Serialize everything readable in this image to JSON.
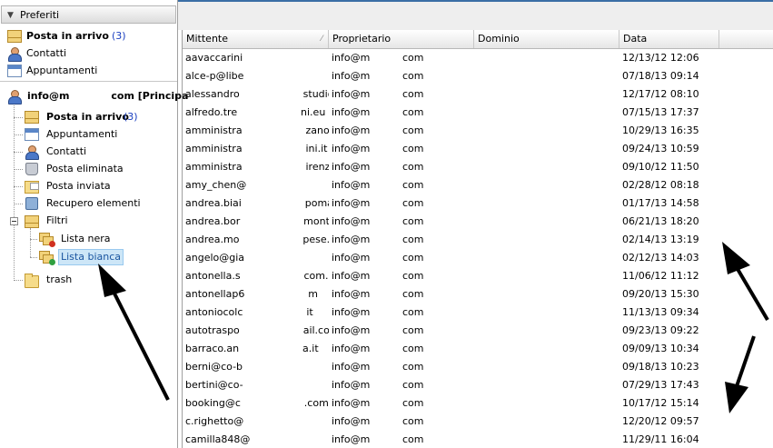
{
  "favorites": {
    "header": "Preferiti",
    "items": [
      {
        "label": "Posta in arrivo",
        "count": "(3)",
        "icon": "inbox-icon",
        "bold": true
      },
      {
        "label": "Contatti",
        "icon": "contacts-icon",
        "bold": false
      },
      {
        "label": "Appuntamenti",
        "icon": "calendar-icon",
        "bold": false
      }
    ]
  },
  "account": {
    "label": "info@m            com [Principa",
    "folders": [
      {
        "label": "Posta in arrivo",
        "count": "(3)",
        "icon": "inbox-icon",
        "bold": true
      },
      {
        "label": "Appuntamenti",
        "icon": "calendar-icon"
      },
      {
        "label": "Contatti",
        "icon": "contacts-icon"
      },
      {
        "label": "Posta eliminata",
        "icon": "trash-can-icon"
      },
      {
        "label": "Posta inviata",
        "icon": "sent-mail-icon"
      },
      {
        "label": "Recupero elementi",
        "icon": "recover-items-icon"
      },
      {
        "label": "Filtri",
        "icon": "filters-icon"
      },
      {
        "label": "Lista nera",
        "icon": "blacklist-icon"
      },
      {
        "label": "Lista bianca",
        "icon": "whitelist-icon"
      },
      {
        "label": "trash",
        "icon": "folder-icon"
      }
    ]
  },
  "grid": {
    "columns": [
      "Mittente",
      "Proprietario",
      "Dominio",
      "Data"
    ],
    "rows": [
      {
        "sender": "aavaccarini",
        "owner": "info@m",
        "domain": "com",
        "date": "12/13/12 12:06"
      },
      {
        "sender": "alce-p@libe",
        "owner": "info@m",
        "domain": "com",
        "date": "07/18/13 09:14"
      },
      {
        "sender": "alessandro                    studio.it",
        "owner": "info@m",
        "domain": "com",
        "date": "12/17/12 08:10"
      },
      {
        "sender": "alfredo.tre                    ni.eu",
        "owner": "info@m",
        "domain": "com",
        "date": "07/15/13 17:37"
      },
      {
        "sender": "amministra                    zanoasf",
        "owner": "info@m",
        "domain": "com",
        "date": "10/29/13 16:35"
      },
      {
        "sender": "amministra                    ini.it",
        "owner": "info@m",
        "domain": "com",
        "date": "09/24/13 10:59"
      },
      {
        "sender": "amministra                    irenzosp",
        "owner": "info@m",
        "domain": "com",
        "date": "09/10/12 11:50"
      },
      {
        "sender": "amy_chen@",
        "owner": "info@m",
        "domain": "com",
        "date": "02/28/12 08:18"
      },
      {
        "sender": "andrea.biai                    pomann",
        "owner": "info@m",
        "domain": "com",
        "date": "01/17/13 14:58"
      },
      {
        "sender": "andrea.bor                    montana",
        "owner": "info@m",
        "domain": "com",
        "date": "06/21/13 18:20"
      },
      {
        "sender": "andrea.mo                    pese.co",
        "owner": "info@m",
        "domain": "com",
        "date": "02/14/13 13:19"
      },
      {
        "sender": "angelo@gia",
        "owner": "info@m",
        "domain": "com",
        "date": "02/12/13 14:03"
      },
      {
        "sender": "antonella.s                    com.it",
        "owner": "info@m",
        "domain": "com",
        "date": "11/06/12 11:12"
      },
      {
        "sender": "antonellap6                    m",
        "owner": "info@m",
        "domain": "com",
        "date": "09/20/13 15:30"
      },
      {
        "sender": "antoniocolc                    it",
        "owner": "info@m",
        "domain": "com",
        "date": "11/13/13 09:34"
      },
      {
        "sender": "autotraspo                    ail.com",
        "owner": "info@m",
        "domain": "com",
        "date": "09/23/13 09:22"
      },
      {
        "sender": "barraco.an                    a.it",
        "owner": "info@m",
        "domain": "com",
        "date": "09/09/13 10:34"
      },
      {
        "sender": "berni@co-b",
        "owner": "info@m",
        "domain": "com",
        "date": "09/18/13 10:23"
      },
      {
        "sender": "bertini@co-",
        "owner": "info@m",
        "domain": "com",
        "date": "07/29/13 17:43"
      },
      {
        "sender": "booking@c                    .com",
        "owner": "info@m",
        "domain": "com",
        "date": "10/17/12 15:14"
      },
      {
        "sender": "c.righetto@",
        "owner": "info@m",
        "domain": "com",
        "date": "12/20/12 09:57"
      },
      {
        "sender": "camilla848@",
        "owner": "info@m",
        "domain": "com",
        "date": "11/29/11 16:04"
      }
    ]
  },
  "colors": {
    "accent": "#3a6ea5",
    "selection": "#cde6f7",
    "count": "#1a3fc0"
  }
}
